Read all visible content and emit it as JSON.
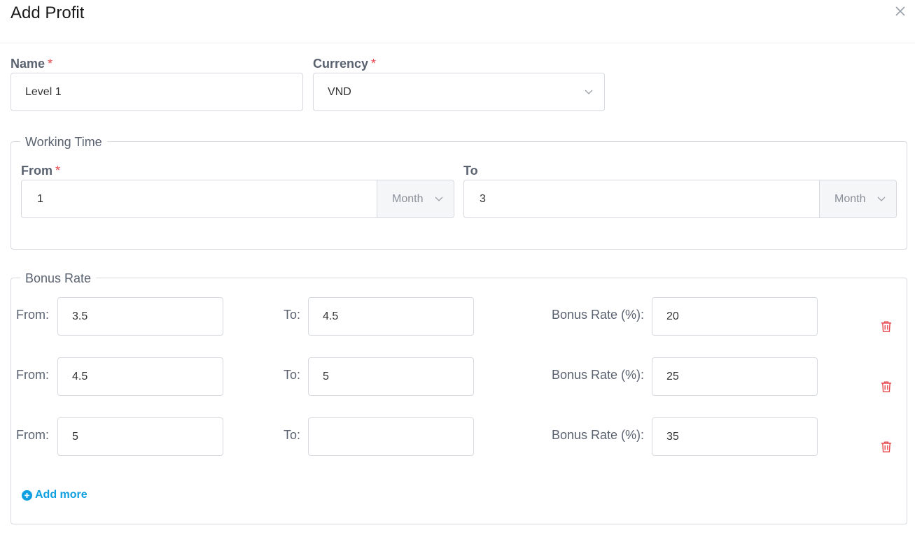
{
  "header": {
    "title": "Add Profit",
    "close_icon": "close-icon"
  },
  "form": {
    "name": {
      "label": "Name",
      "required_mark": "*",
      "value": "Level 1"
    },
    "currency": {
      "label": "Currency",
      "required_mark": "*",
      "value": "VND"
    }
  },
  "working_time": {
    "legend": "Working Time",
    "from": {
      "label": "From",
      "required_mark": "*",
      "value": "1",
      "unit": "Month"
    },
    "to": {
      "label": "To",
      "value": "3",
      "unit": "Month"
    }
  },
  "bonus_rate": {
    "legend": "Bonus Rate",
    "from_label": "From:",
    "to_label": "To:",
    "rate_label": "Bonus Rate (%):",
    "rows": [
      {
        "from": "3.5",
        "to": "4.5",
        "rate": "20"
      },
      {
        "from": "4.5",
        "to": "5",
        "rate": "25"
      },
      {
        "from": "5",
        "to": "",
        "rate": "35"
      }
    ],
    "add_more_label": "Add more"
  },
  "colors": {
    "accent": "#0e9fe0",
    "required": "#e5484d",
    "delete": "#e5484d"
  }
}
